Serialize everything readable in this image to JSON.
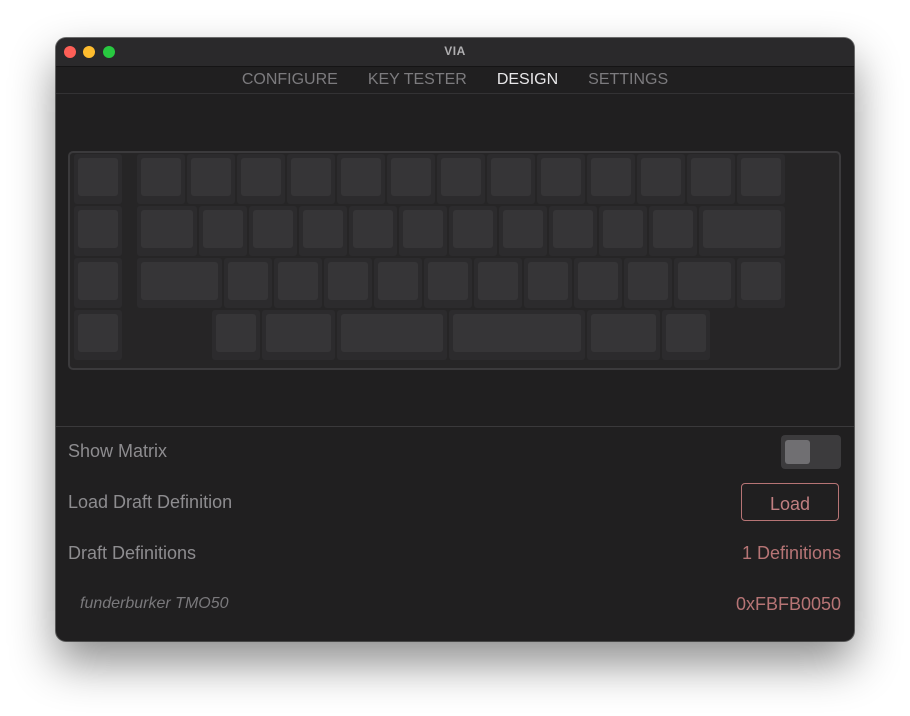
{
  "window": {
    "title": "VIA"
  },
  "nav": {
    "tabs": [
      {
        "label": "CONFIGURE",
        "active": false
      },
      {
        "label": "KEY TESTER",
        "active": false
      },
      {
        "label": "DESIGN",
        "active": true
      },
      {
        "label": "SETTINGS",
        "active": false
      }
    ]
  },
  "keyboard": {
    "name": "keyboard-layout-preview",
    "rows": 4
  },
  "settings": {
    "show_matrix": {
      "label": "Show Matrix",
      "enabled": false
    },
    "load_draft": {
      "label": "Load Draft Definition",
      "button_label": "Load"
    },
    "draft_definitions": {
      "label": "Draft Definitions",
      "value": "1 Definitions"
    },
    "definitions": [
      {
        "name": "funderburker TMO50",
        "id": "0xFBFB0050"
      }
    ]
  },
  "colors": {
    "accent": "#b67475",
    "background": "#201f20",
    "active_tab": "#e8e7e9",
    "inactive_tab": "#7c7b7e"
  }
}
